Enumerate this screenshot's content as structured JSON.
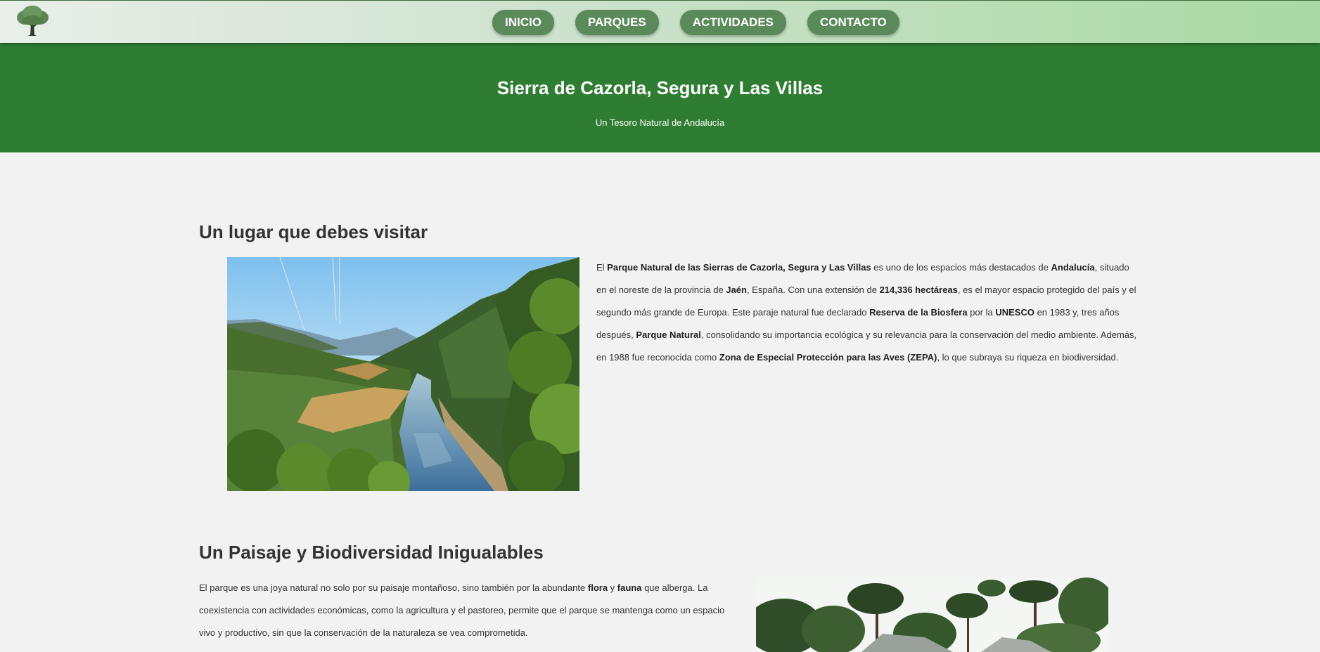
{
  "nav": {
    "logo_icon": "tree-icon",
    "links": [
      "INICIO",
      "PARQUES",
      "ACTIVIDADES",
      "CONTACTO"
    ],
    "colors": {
      "button": "#5a8a5a",
      "text": "#ffffff"
    }
  },
  "hero": {
    "title": "Sierra de Cazorla, Segura y Las Villas",
    "subtitle": "Un Tesoro Natural de Andalucía",
    "background": "#2e7d32"
  },
  "section1": {
    "title": "Un lugar que debes visitar",
    "image_icon": "river-valley-photo",
    "p1": "El ",
    "b1": "Parque Natural de las Sierras de Cazorla, Segura y Las Villas",
    "p2": " es uno de los espacios más destacados de ",
    "b2": "Andalucía",
    "p3": ", situado en el noreste de la provincia de ",
    "b3": "Jaén",
    "p4": ", España. Con una extensión de ",
    "b4": "214,336 hectáreas",
    "p5": ", es el mayor espacio protegido del país y el segundo más grande de Europa. Este paraje natural fue declarado ",
    "b5": "Reserva de la Biosfera",
    "p6": " por la ",
    "b6": "UNESCO",
    "p7": " en 1983 y, tres años después, ",
    "b7": "Parque Natural",
    "p8": ", consolidando su importancia ecológica y su relevancia para la conservación del medio ambiente. Además, en 1988 fue reconocida como ",
    "b8": "Zona de Especial Protección para las Aves (ZEPA)",
    "p9": ", lo que subraya su riqueza en biodiversidad."
  },
  "section2": {
    "title": "Un Paisaje y Biodiversidad Inigualables",
    "image_icon": "pine-forest-photo",
    "p1": "El parque es una joya natural no solo por su paisaje montañoso, sino también por la abundante ",
    "b1": "flora",
    "p2": " y ",
    "b2": "fauna",
    "p3": " que alberga. La coexistencia con actividades económicas, como la agricultura y el pastoreo, permite que el parque se mantenga como un espacio vivo y productivo, sin que la conservación de la naturaleza se vea comprometida."
  }
}
